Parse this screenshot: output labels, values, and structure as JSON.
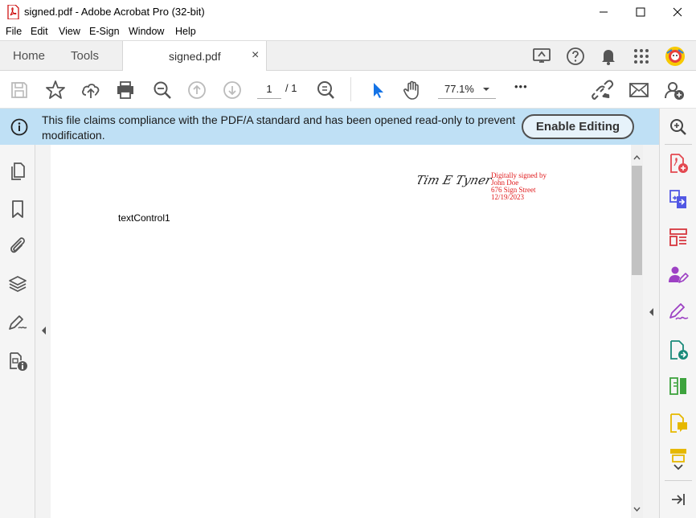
{
  "window": {
    "title": "signed.pdf - Adobe Acrobat Pro (32-bit)"
  },
  "menu": {
    "items": [
      "File",
      "Edit",
      "View",
      "E-Sign",
      "Window",
      "Help"
    ]
  },
  "tabs": {
    "home": "Home",
    "tools": "Tools",
    "document": "signed.pdf",
    "close": "×"
  },
  "toolbar": {
    "page_current": "1",
    "page_total": "/ 1",
    "zoom": "77.1%",
    "more": "•••"
  },
  "banner": {
    "message": "This file claims compliance with the PDF/A standard and has been opened read-only to prevent modification.",
    "button": "Enable Editing"
  },
  "document": {
    "signature_script": "Tim E Tyner",
    "signature_lines": [
      "Digitally signed by",
      "John Doe",
      "676 Sign Street",
      "12/19/2023"
    ],
    "text_field": "textControl1"
  },
  "colors": {
    "banner_bg": "#bfe0f5",
    "signature_text": "#e0191b",
    "selection_blue": "#1473e6"
  },
  "icons": {
    "left_rail": [
      "pages-icon",
      "bookmark-icon",
      "attachment-icon",
      "layers-icon",
      "signature-panel-icon",
      "content-icon"
    ],
    "right_rail": [
      "zoom-search-icon",
      "create-pdf-icon",
      "combine-files-icon",
      "organize-pages-icon",
      "request-signature-icon",
      "fill-sign-icon",
      "export-pdf-icon",
      "compare-icon",
      "comment-icon",
      "print-production-icon",
      "expand-more-icon",
      "collapse-rail-icon"
    ]
  }
}
